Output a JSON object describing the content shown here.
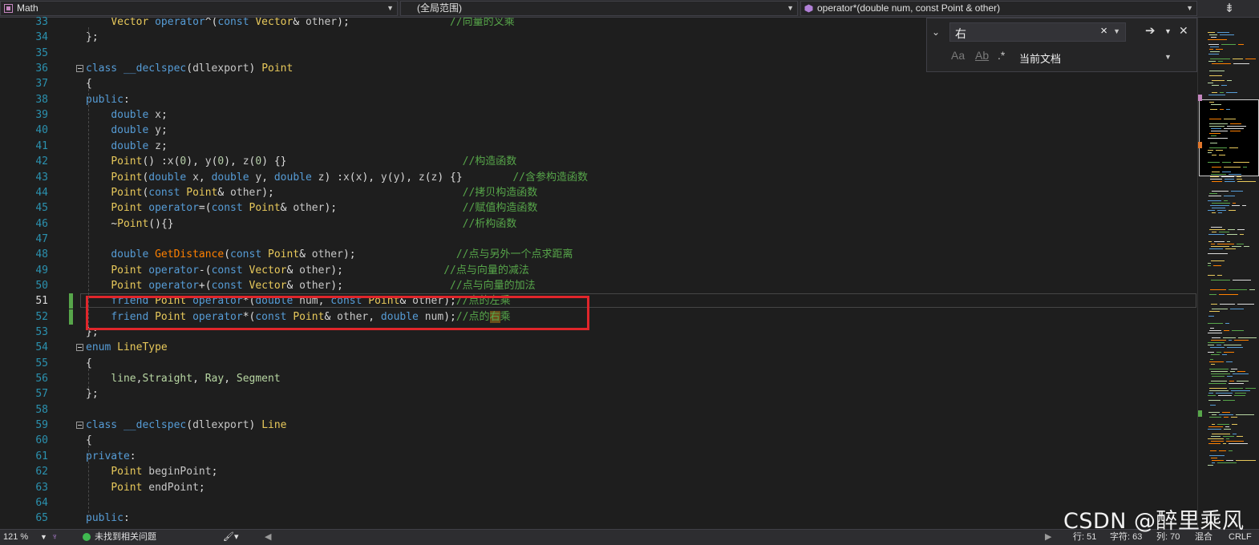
{
  "navbar": {
    "project": "Math",
    "scope": "(全局范围)",
    "member": "operator*(double num, const Point & other)",
    "split_icon": "split-pane-icon"
  },
  "find": {
    "query": "右",
    "scope": "当前文档",
    "options": [
      "Aa",
      "Ab",
      ".*"
    ]
  },
  "editor": {
    "current_line": 51,
    "changed_lines": [
      51,
      52
    ],
    "lines": [
      {
        "n": 33,
        "text": "    Vector operator^(const Vector& other);                //向量的叉乘"
      },
      {
        "n": 34,
        "text": "};"
      },
      {
        "n": 35,
        "text": ""
      },
      {
        "n": 36,
        "text": "class __declspec(dllexport) Point"
      },
      {
        "n": 37,
        "text": "{"
      },
      {
        "n": 38,
        "text": "public:"
      },
      {
        "n": 39,
        "text": "    double x;"
      },
      {
        "n": 40,
        "text": "    double y;"
      },
      {
        "n": 41,
        "text": "    double z;"
      },
      {
        "n": 42,
        "text": "    Point() :x(0), y(0), z(0) {}                            //构造函数"
      },
      {
        "n": 43,
        "text": "    Point(double x, double y, double z) :x(x), y(y), z(z) {}        //含参构造函数"
      },
      {
        "n": 44,
        "text": "    Point(const Point& other);                              //拷贝构造函数"
      },
      {
        "n": 45,
        "text": "    Point operator=(const Point& other);                    //赋值构造函数"
      },
      {
        "n": 46,
        "text": "    ~Point(){}                                              //析构函数"
      },
      {
        "n": 47,
        "text": ""
      },
      {
        "n": 48,
        "text": "    double GetDistance(const Point& other);                //点与另外一个点求距离"
      },
      {
        "n": 49,
        "text": "    Point operator-(const Vector& other);                //点与向量的减法"
      },
      {
        "n": 50,
        "text": "    Point operator+(const Vector& other);                 //点与向量的加法"
      },
      {
        "n": 51,
        "text": "    friend Point operator*(double num, const Point& other);//点的左乘"
      },
      {
        "n": 52,
        "text": "    friend Point operator*(const Point& other, double num);//点的右乘"
      },
      {
        "n": 53,
        "text": "};"
      },
      {
        "n": 54,
        "text": "enum LineType"
      },
      {
        "n": 55,
        "text": "{"
      },
      {
        "n": 56,
        "text": "    line,Straight, Ray, Segment"
      },
      {
        "n": 57,
        "text": "};"
      },
      {
        "n": 58,
        "text": ""
      },
      {
        "n": 59,
        "text": "class __declspec(dllexport) Line"
      },
      {
        "n": 60,
        "text": "{"
      },
      {
        "n": 61,
        "text": "private:"
      },
      {
        "n": 62,
        "text": "    Point beginPoint;"
      },
      {
        "n": 63,
        "text": "    Point endPoint;"
      },
      {
        "n": 64,
        "text": ""
      },
      {
        "n": 65,
        "text": "public:"
      }
    ]
  },
  "status": {
    "zoom": "121 %",
    "issues": "未找到相关问题",
    "line": "行: 51",
    "char": "字符: 63",
    "col": "列: 70",
    "mode": "混合",
    "eol": "CRLF"
  },
  "watermark": "CSDN @醉里乘风",
  "colors": {
    "keyword": "#569cd6",
    "class": "#e8c95b",
    "function": "#ff8000",
    "comment": "#57a64a",
    "enum": "#b8d7a3",
    "changed": "#57a64a",
    "annotation_box": "#e0262b"
  }
}
